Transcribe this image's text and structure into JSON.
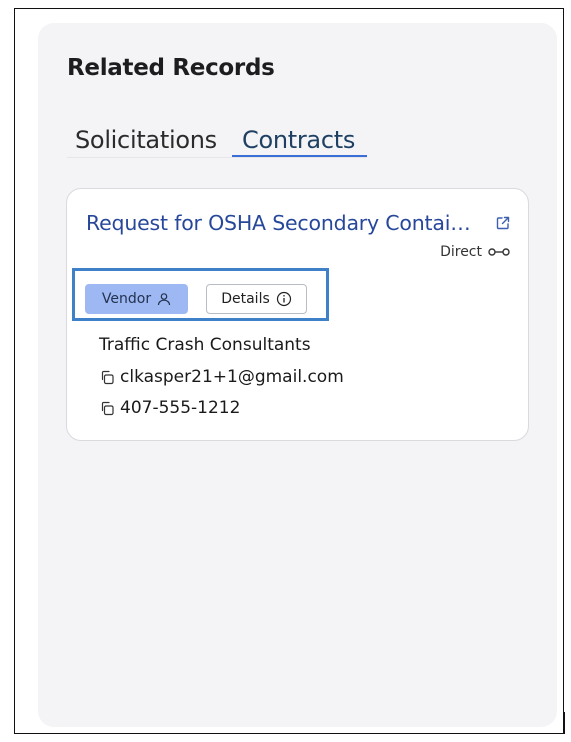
{
  "panel": {
    "title": "Related Records",
    "tabs": [
      {
        "label": "Solicitations",
        "active": false
      },
      {
        "label": "Contracts",
        "active": true
      }
    ]
  },
  "card": {
    "title": "Request for OSHA Secondary Contai…",
    "relation": "Direct",
    "buttons": {
      "vendor": "Vendor",
      "details": "Details"
    },
    "vendor": {
      "name": "Traffic Crash Consultants",
      "email": "clkasper21+1@gmail.com",
      "phone": "407-555-1212"
    }
  },
  "colors": {
    "accent": "#3a6fd8",
    "link": "#27489a",
    "vendor_button": "#9db8f2",
    "highlight_box": "#3f81c8"
  },
  "icons": [
    "external-link-icon",
    "link-chain-icon",
    "person-icon",
    "info-icon",
    "copy-icon"
  ]
}
